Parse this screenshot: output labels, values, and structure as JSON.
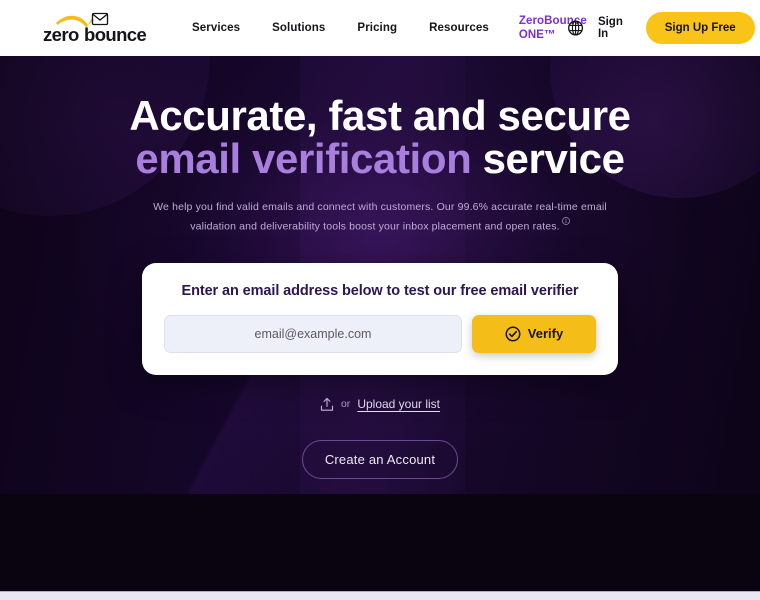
{
  "header": {
    "logo": {
      "text_zero": "zero",
      "text_bounce": "bounce",
      "name": "zerobounce-logo"
    },
    "nav": [
      {
        "label": "Services",
        "accent": false
      },
      {
        "label": "Solutions",
        "accent": false
      },
      {
        "label": "Pricing",
        "accent": false
      },
      {
        "label": "Resources",
        "accent": false
      },
      {
        "label": "ZeroBounce ONE™",
        "accent": true
      }
    ],
    "language_icon": "globe-icon",
    "sign_in_label": "Sign In",
    "sign_up_label": "Sign Up Free"
  },
  "hero": {
    "title_line1": "Accurate, fast and secure",
    "title_line2_accent": "email verification",
    "title_line2_rest": " service",
    "subtitle": "We help you find valid emails and connect with customers. Our 99.6% accurate real-time email validation and deliverability tools boost your inbox placement and open rates.",
    "info_icon": "info-circle-icon",
    "card": {
      "title": "Enter an email address below to test our free email verifier",
      "input_placeholder": "email@example.com",
      "input_value": "",
      "verify_label": "Verify",
      "verify_icon": "check-circle-icon"
    },
    "upload": {
      "icon": "upload-icon",
      "or_label": "or",
      "link_label": "Upload your list"
    },
    "create_account_label": "Create an Account"
  },
  "colors": {
    "brand_yellow": "#f5bd17",
    "brand_purple": "#7b2fd4",
    "hero_accent_text": "#a97fdd",
    "card_title": "#2d1552",
    "hero_bg_dark": "#0e0419",
    "bottom_strip": "#ebe6f4"
  }
}
